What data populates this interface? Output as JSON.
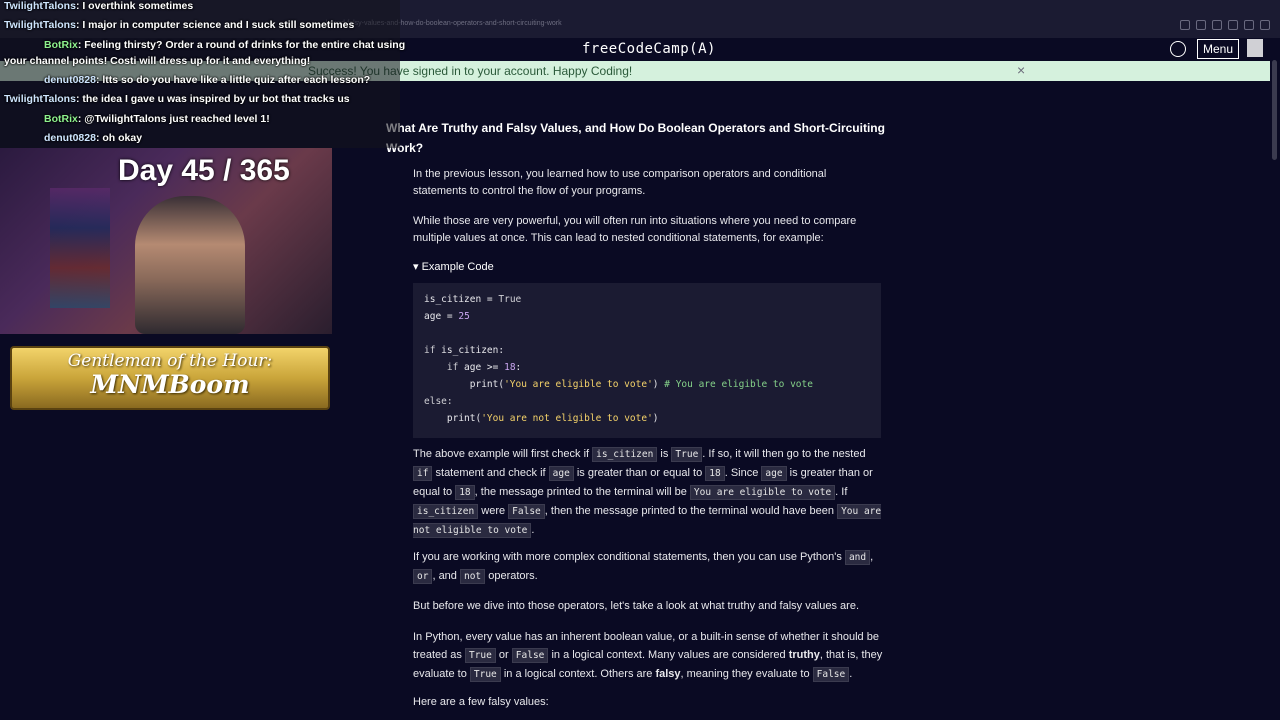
{
  "browser": {
    "url": "...ly-and-falsy-values-and-how-do-boolean-operators-and-short-circuiting-work"
  },
  "header": {
    "logo": "freeCodeCamp(A)",
    "menu_label": "Menu"
  },
  "flash": {
    "message": "Success! You have signed in to your account. Happy Coding!",
    "close": "×"
  },
  "lesson": {
    "title": "What Are Truthy and Falsy Values, and How Do Boolean Operators and Short-Circuiting Work?",
    "p1": "In the previous lesson, you learned how to use comparison operators and conditional statements to control the flow of your programs.",
    "p2": "While those are very powerful, you will often run into situations where you need to compare multiple values at once. This can lead to nested conditional statements, for example:",
    "example_summary": "▾ Example Code",
    "code": {
      "l1a": "is_citizen",
      "l1b": " = ",
      "l1c": "True",
      "l2a": "age",
      "l2b": " = ",
      "l2c": "25",
      "l3a": "if ",
      "l3b": "is_citizen:",
      "l4a": "    if ",
      "l4b": "age >= ",
      "l4c": "18",
      "l4d": ":",
      "l5a": "        print(",
      "l5b": "'You are eligible to vote'",
      "l5c": ") ",
      "l5d": "# You are eligible to vote",
      "l6a": "else:",
      "l7a": "    print(",
      "l7b": "'You are not eligible to vote'",
      "l7c": ")"
    },
    "p3": {
      "t1": "The above example will first check if ",
      "c1": "is_citizen",
      "t2": " is ",
      "c2": "True",
      "t3": ". If so, it will then go to the nested ",
      "c3": "if",
      "t4": " statement and check if ",
      "c4": "age",
      "t5": " is greater than or equal to ",
      "c5": "18",
      "t6": ". Since ",
      "c6": "age",
      "t7": " is greater than or equal to ",
      "c7": "18",
      "t8": ", the message printed to the terminal will be ",
      "c8": "You are eligible to vote",
      "t9": ". If ",
      "c9": "is_citizen",
      "t10": " were ",
      "c10": "False",
      "t11": ", then the message printed to the terminal would have been ",
      "c11": "You are not eligible to vote",
      "t12": "."
    },
    "p4": {
      "t1": "If you are working with more complex conditional statements, then you can use Python's ",
      "c1": "and",
      "t2": ", ",
      "c2": "or",
      "t3": ", and ",
      "c3": "not",
      "t4": " operators."
    },
    "p5": "But before we dive into those operators, let's take a look at what truthy and falsy values are.",
    "p6": {
      "t1": "In Python, every value has an inherent boolean value, or a built-in sense of whether it should be treated as ",
      "c1": "True",
      "t2": " or ",
      "c2": "False",
      "t3": " in a logical context. Many values are considered ",
      "b1": "truthy",
      "t4": ", that is, they evaluate to ",
      "c3": "True",
      "t5": " in a logical context. Others are ",
      "b2": "falsy",
      "t6": ", meaning they evaluate to ",
      "c4": "False",
      "t7": "."
    },
    "p7": "Here are a few falsy values:"
  },
  "stream": {
    "chat": [
      {
        "user": "TwilightTalons",
        "msg": ": I overthink sometimes"
      },
      {
        "user": "TwilightTalons",
        "msg": ": I major in computer science and I suck still sometimes"
      },
      {
        "user": "BotRix",
        "msg": ": Feeling thirsty? Order a round of drinks for the entire chat using"
      },
      {
        "user": "",
        "msg": "your channel points! Costi will dress up for it and everything!"
      },
      {
        "user": "denut0828",
        "msg": ": ltts so do you have like a little quiz after each lesson?"
      },
      {
        "user": "TwilightTalons",
        "msg": ": the idea I gave u was inspired by ur bot that tracks us"
      },
      {
        "user": "BotRix",
        "msg": ": @TwilightTalons just reached level 1!"
      },
      {
        "user": "denut0828",
        "msg": ": oh okay"
      }
    ],
    "day_counter": "Day 45 / 365",
    "banner_line1": "Gentleman of the Hour:",
    "banner_line2": "MNMBoom"
  }
}
